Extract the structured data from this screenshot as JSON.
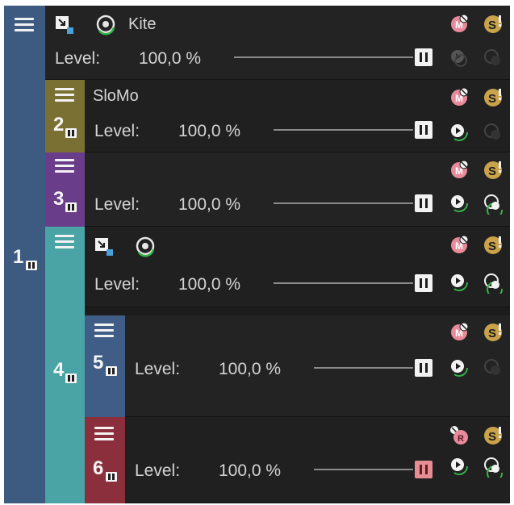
{
  "colors": {
    "track1": "#3d5a80",
    "track2": "#7a7033",
    "track3": "#6a3d8a",
    "track4": "#4aa3a5",
    "track5": "#3f5d86",
    "track6": "#8b2f3d",
    "mute_pink": "#e98a9a",
    "solo_gold": "#c9a24a",
    "accent_green": "#35b34a"
  },
  "tracks": [
    {
      "number": "1",
      "name": "Kite",
      "level_label": "Level:",
      "level_value": "100,0 %",
      "level": 1.0
    },
    {
      "number": "2",
      "name": "SloMo",
      "level_label": "Level:",
      "level_value": "100,0 %",
      "level": 1.0
    },
    {
      "number": "3",
      "name": "",
      "level_label": "Level:",
      "level_value": "100,0 %",
      "level": 1.0
    },
    {
      "number": "4",
      "name": "",
      "level_label": "Level:",
      "level_value": "100,0 %",
      "level": 1.0
    },
    {
      "number": "5",
      "name": "",
      "level_label": "Level:",
      "level_value": "100,0 %",
      "level": 1.0
    },
    {
      "number": "6",
      "name": "",
      "level_label": "Level:",
      "level_value": "100,0 %",
      "level": 1.0
    }
  ],
  "icons": {
    "menu": "hamburger-menu-icon",
    "film": "film-strip-icon",
    "fx": "track-fx-icon",
    "composite": "composite-mode-icon",
    "mute": "mute-icon",
    "solo": "solo-icon",
    "motion": "motion-blur-icon",
    "lock": "lock-envelope-icon",
    "record": "record-arm-icon"
  }
}
